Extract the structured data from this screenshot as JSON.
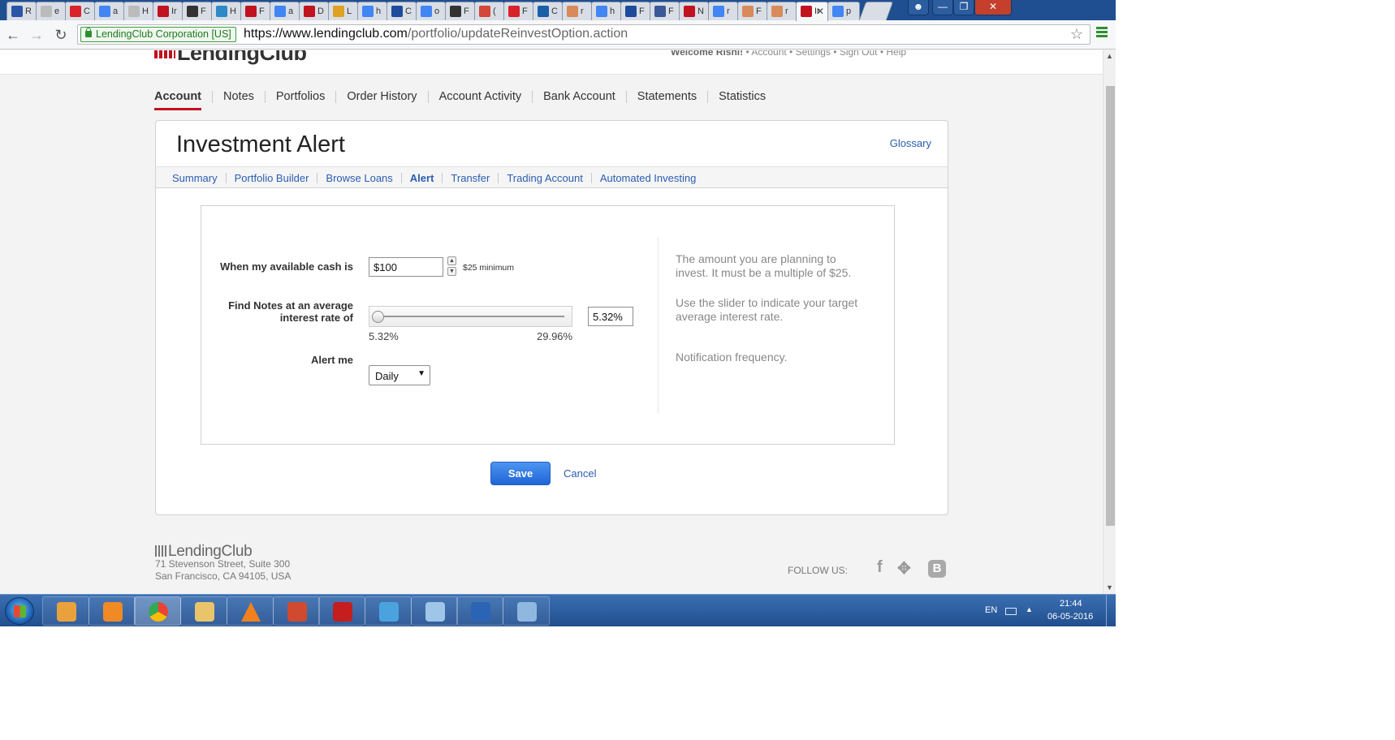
{
  "browser": {
    "tabs": [
      {
        "label": "R",
        "color": "#2a56a6"
      },
      {
        "label": "e",
        "color": "#bbbbbb"
      },
      {
        "label": "C",
        "color": "#d8232a"
      },
      {
        "label": "a",
        "color": "#4285f4"
      },
      {
        "label": "H",
        "color": "#bbbbbb"
      },
      {
        "label": "Ir",
        "color": "#c1121f"
      },
      {
        "label": "F",
        "color": "#333333"
      },
      {
        "label": "H",
        "color": "#2d8ac7"
      },
      {
        "label": "F",
        "color": "#c1121f"
      },
      {
        "label": "a",
        "color": "#4285f4"
      },
      {
        "label": "D",
        "color": "#c1121f"
      },
      {
        "label": "L",
        "color": "#e0a020"
      },
      {
        "label": "h",
        "color": "#4285f4"
      },
      {
        "label": "C",
        "color": "#1e4b9b"
      },
      {
        "label": "o",
        "color": "#4285f4"
      },
      {
        "label": "F",
        "color": "#333333"
      },
      {
        "label": "(",
        "color": "#d44638"
      },
      {
        "label": "F",
        "color": "#d8232a"
      },
      {
        "label": "C",
        "color": "#1b5fa8"
      },
      {
        "label": "r",
        "color": "#d98a5a"
      },
      {
        "label": "h",
        "color": "#4285f4"
      },
      {
        "label": "F",
        "color": "#1e4b9b"
      },
      {
        "label": "F",
        "color": "#3b5998"
      },
      {
        "label": "N",
        "color": "#c1121f"
      },
      {
        "label": "r",
        "color": "#4285f4"
      },
      {
        "label": "F",
        "color": "#d98a5a"
      },
      {
        "label": "r",
        "color": "#d98a5a"
      },
      {
        "label": "Ir",
        "color": "#c1121f",
        "active": true
      },
      {
        "label": "p",
        "color": "#4285f4"
      }
    ],
    "ev_label": "LendingClub Corporation [US]",
    "url_scheme_host": "https://www.lendingclub.com",
    "url_path": "/portfolio/updateReinvestOption.action"
  },
  "site": {
    "logo": "LendingClub",
    "welcome": "Welcome Rishi!",
    "top_links": "• Account • Settings • Sign Out • Help",
    "main_nav": [
      "Account",
      "Notes",
      "Portfolios",
      "Order History",
      "Account Activity",
      "Bank Account",
      "Statements",
      "Statistics"
    ]
  },
  "card": {
    "title": "Investment Alert",
    "glossary": "Glossary",
    "sub_nav": [
      "Summary",
      "Portfolio Builder",
      "Browse Loans",
      "Alert",
      "Transfer",
      "Trading Account",
      "Automated Investing"
    ],
    "active_sub": "Alert"
  },
  "form": {
    "cash_label": "When my available cash is",
    "cash_value": "$100",
    "cash_hint": "$25 minimum",
    "rate_label_1": "Find Notes at an average",
    "rate_label_2": "interest rate of",
    "rate_min": "5.32%",
    "rate_max": "29.96%",
    "rate_value": "5.32%",
    "rate_slider_fraction": 0,
    "alert_label": "Alert me",
    "alert_value": "Daily",
    "help_cash": "The amount you are planning to invest. It must be a multiple of $25.",
    "help_rate": "Use the slider to indicate your target average interest rate.",
    "help_alert": "Notification frequency.",
    "save": "Save",
    "cancel": "Cancel"
  },
  "footer": {
    "logo": "LendingClub",
    "address_1": "71 Stevenson Street, Suite 300",
    "address_2": "San Francisco, CA 94105, USA",
    "follow": "FOLLOW US:",
    "social": [
      "facebook-icon",
      "twitter-icon",
      "blogger-icon"
    ],
    "blog_letter": "B"
  },
  "taskbar": {
    "apps": [
      {
        "name": "orange-app-icon",
        "color": "#e9a23b"
      },
      {
        "name": "media-player-icon",
        "color": "#f08a24"
      },
      {
        "name": "chrome-icon",
        "color": "#34a853"
      },
      {
        "name": "file-explorer-icon",
        "color": "#e9c46a"
      },
      {
        "name": "vlc-icon",
        "color": "#f2811d"
      },
      {
        "name": "presentation-icon",
        "color": "#d04a2f"
      },
      {
        "name": "pdf-reader-icon",
        "color": "#c41e1e"
      },
      {
        "name": "image-viewer-icon",
        "color": "#4aa3df"
      },
      {
        "name": "notes-app-icon",
        "color": "#9fc5e8"
      },
      {
        "name": "r-app-icon",
        "color": "#2b64b5"
      },
      {
        "name": "paint-icon",
        "color": "#8fb7e0"
      }
    ],
    "lang": "EN",
    "time": "21:44",
    "date": "06-05-2016"
  }
}
